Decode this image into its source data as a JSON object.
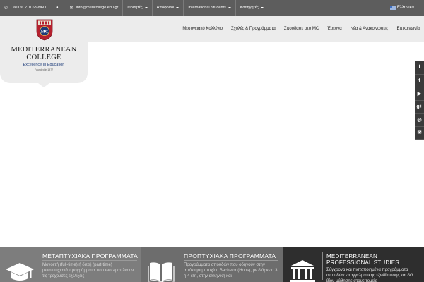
{
  "topbar": {
    "phone_icon": "phone-icon",
    "phone": "Call us: 210 6899600",
    "chat_icon": "chat-icon",
    "mail_icon": "mail-icon",
    "email": "info@medcollege.edu.gr",
    "menus": [
      "Φοιτητές",
      "Απόφοιτοι",
      "International Students",
      "Καθηγητές"
    ],
    "language": "Ελληνικά"
  },
  "logo": {
    "crest_initials": "MC",
    "name_line1": "MEDITERRANEAN",
    "name_line2": "COLLEGE",
    "tagline": "Excellence In Education",
    "founded": "Founded in 1977"
  },
  "nav": [
    "Μεσογειακό Κολλέγιο",
    "Σχολές & Προγράμματα",
    "Σπούδασε στο MC",
    "Έρευνα",
    "Νέα & Ανακοινώσεις",
    "Επικοινωνία"
  ],
  "social": [
    {
      "icon": "facebook-icon",
      "glyph": "f"
    },
    {
      "icon": "twitter-icon",
      "glyph": "t"
    },
    {
      "icon": "youtube-icon",
      "glyph": "▶"
    },
    {
      "icon": "google-plus-icon",
      "glyph": "g+"
    },
    {
      "icon": "instagram-icon",
      "glyph": "◎"
    },
    {
      "icon": "envelope-icon",
      "glyph": "✉"
    }
  ],
  "panels": [
    {
      "icon": "graduation-cap-icon",
      "title": "ΜΕΤΑΠΤΥΧΙΑΚΑ ΠΡΟΓΡΑΜΜΑΤΑ",
      "text": "Μονοετή (full-time) ή διετή (part-time) μεταπτυχιακά προγράμματα που ενσωματώνουν τις τρέχουσες εξελίξεις"
    },
    {
      "icon": "open-book-icon",
      "title": "ΠΡΟΠΤΥΧΙΑΚΑ ΠΡΟΓΡΑΜΜΑΤΑ",
      "text": "Προγράμματα σπουδών που οδηγούν στην απόκτηση πτυχίου Bachelor (Hons), με διάρκεια 3 ή 4 έτη, στην ελληνική και"
    },
    {
      "icon": "institution-icon",
      "title": "MEDITERRANEAN PROFESSIONAL STUDIES",
      "text": "Σύγχρονα και πιστοποιημένα προγράμματα σπουδών επαγγελματικής εξειδίκευσης και διά βίου μάθησης στους τομείς"
    }
  ]
}
